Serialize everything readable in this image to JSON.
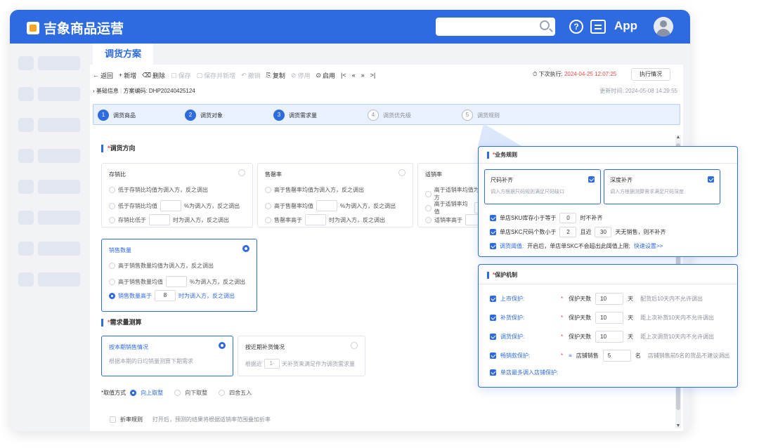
{
  "app": {
    "title": "吉象商品运营",
    "app_label": "App",
    "help_glyph": "?"
  },
  "page_tab": "调货方案",
  "toolbar": {
    "items": [
      {
        "icon": "←",
        "label": "返回",
        "enabled": true
      },
      {
        "icon": "+",
        "label": "新增",
        "enabled": true
      },
      {
        "icon": "⌫",
        "label": "删除",
        "enabled": true
      },
      {
        "icon": "▢",
        "label": "保存",
        "enabled": false
      },
      {
        "icon": "▢",
        "label": "保存并新增",
        "enabled": false
      },
      {
        "icon": "↶",
        "label": "撤销",
        "enabled": false
      },
      {
        "icon": "⎘",
        "label": "复制",
        "enabled": true
      },
      {
        "icon": "⊘",
        "label": "停用",
        "enabled": false
      },
      {
        "icon": "⊙",
        "label": "启用",
        "enabled": true
      },
      {
        "icon": "|<",
        "label": "",
        "enabled": true
      },
      {
        "icon": "«",
        "label": "",
        "enabled": true
      },
      {
        "icon": "»",
        "label": "",
        "enabled": true
      },
      {
        "icon": ">|",
        "label": "",
        "enabled": true
      }
    ],
    "next_run_label": "下次执行: ",
    "next_run_time": "2024-04-25 12:07:25",
    "status_button": "执行情况"
  },
  "info": {
    "basic": "基础信息",
    "plan_code": "方案编码: DHP20240425124",
    "updated": "更新时间: 2024-05-08 14:29:55"
  },
  "steps": [
    {
      "num": "1",
      "label": "调货商品",
      "active": true
    },
    {
      "num": "2",
      "label": "调货对象",
      "active": true
    },
    {
      "num": "3",
      "label": "调货需求量",
      "active": true
    },
    {
      "num": "4",
      "label": "调货优先级",
      "active": false
    },
    {
      "num": "5",
      "label": "调货规则",
      "active": false
    }
  ],
  "direction": {
    "title": "调货方向",
    "required_mark": "*",
    "cards": [
      {
        "title": "存销比",
        "options": [
          {
            "pre": "低于存销比均值为调入方，反之调出",
            "box": "",
            "post": ""
          },
          {
            "pre": "低于存销比均值",
            "box": "",
            "post": "%为调入方，反之调出"
          },
          {
            "pre": "存销比低于",
            "box": "",
            "post": "时为调入方，反之调出"
          }
        ]
      },
      {
        "title": "售罄率",
        "options": [
          {
            "pre": "高于售罄率均值为调入方，反之调出",
            "box": "",
            "post": ""
          },
          {
            "pre": "高于售罄率均值",
            "box": "",
            "post": "%为调入方，反之调出"
          },
          {
            "pre": "售罄率高于",
            "box": "",
            "post": "时为调入方，反之调出"
          }
        ]
      },
      {
        "title": "适销率",
        "options": [
          {
            "pre": "高于适销率均值为调入方",
            "box": "",
            "post": ""
          },
          {
            "pre": "高于适销率均值",
            "box": "",
            "post": ""
          },
          {
            "pre": "适销率高于",
            "box": "",
            "post": ""
          }
        ]
      },
      {
        "title": "销售数量",
        "options": [
          {
            "pre": "高于销售数量均值为调入方，反之调出",
            "box": "",
            "post": ""
          },
          {
            "pre": "高于销售数量均值",
            "box": "",
            "post": "%为调入方，反之调出"
          },
          {
            "pre": "销售数量高于",
            "box": "8",
            "post": "时为调入方，反之调出"
          }
        ]
      }
    ]
  },
  "demand": {
    "title": "需求量测算",
    "cards": [
      {
        "title": "按本期销售情况",
        "desc": "根据本期的日均销量测算下期需求"
      },
      {
        "title": "按近期补货情况",
        "desc_pre": "根据近",
        "box": "1-",
        "desc_post": "天补货来满足作为调货需求量"
      }
    ],
    "rounding_label": "*取值方式",
    "rounding_options": [
      "向上取整",
      "向下取整",
      "四舍五入"
    ],
    "rate_rule_label": "折率规则",
    "rate_rule_desc": "打开后，预测的结果将根据适销率范围叠加折率"
  },
  "business_rules": {
    "title": "业务规则",
    "cards": [
      {
        "title": "尺码补齐",
        "desc": "调入方根据尺码规则满足尺码缺口"
      },
      {
        "title": "深度补齐",
        "desc": "调入方根据测算需求满足尺码深度"
      }
    ],
    "rows": [
      {
        "pre": "单店SKU库存小于等于",
        "box": "0",
        "post": "时不补齐"
      },
      {
        "pre": "单店SKC尺码个数小于",
        "box": "2",
        "mid": "且近",
        "box2": "30",
        "post": "天无销售，则不补齐"
      },
      {
        "pre": "调货阈值: ",
        "post": "开启后，单店单SKC不会超出此阈值上限;",
        "link": "快速设置>>"
      }
    ]
  },
  "protection": {
    "title": "保护机制",
    "rows": [
      {
        "label": "上市保护:",
        "field": "保护天数",
        "value": "10",
        "unit": "天",
        "desc": "配货后10天内不允许调出"
      },
      {
        "label": "补货保护:",
        "field": "保护天数",
        "value": "10",
        "unit": "天",
        "desc": "距上次补货10天内不允许调出"
      },
      {
        "label": "调货保护:",
        "field": "保护天数",
        "value": "10",
        "unit": "天",
        "desc": "距上次调货10天内不允许调出"
      },
      {
        "label": "畅销款保护:",
        "field": "店铺销售",
        "value": "5",
        "unit": "名",
        "desc": "店铺销售前5名的货品不建议调出",
        "sel": "≡"
      },
      {
        "label": "单店最多调入店铺保护:",
        "field": "",
        "value": "",
        "unit": "",
        "desc": ""
      }
    ]
  },
  "colors": {
    "accent": "#2e6be0",
    "danger": "#e94a4a",
    "muted": "#9aa0ab"
  }
}
